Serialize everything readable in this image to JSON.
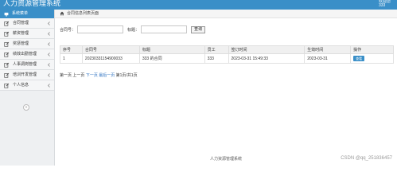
{
  "app": {
    "title": "人力资源管理系统",
    "user_line1": "欢迎您",
    "user_line2": "333"
  },
  "sidebar": {
    "header": "系统菜单",
    "items": [
      {
        "label": "合同管理"
      },
      {
        "label": "薪资管理"
      },
      {
        "label": "奖惩管理"
      },
      {
        "label": "绩效出勤管理"
      },
      {
        "label": "人事调岗管理"
      },
      {
        "label": "培训开发管理"
      },
      {
        "label": "个人信息"
      }
    ],
    "collapse_glyph": "«"
  },
  "breadcrumb": {
    "text": "合同信息列表页面"
  },
  "search": {
    "label1": "合同号：",
    "label2": "标题：",
    "button": "查询",
    "value1": "",
    "value2": ""
  },
  "table": {
    "headers": [
      "序号",
      "合同号",
      "标题",
      "员工",
      "签订时间",
      "生效时间",
      "操作"
    ],
    "rows": [
      [
        "1",
        "20230331154900033",
        "333 的合同",
        "333",
        "2023-03-31 15:49:33",
        "2023-03-31",
        "查看"
      ]
    ]
  },
  "pager": {
    "first": "第一页",
    "prev": "上一页",
    "next": "下一页",
    "last": "最后一页",
    "info": "第1页/共1页"
  },
  "footer": {
    "text": "人力资源管理系统"
  },
  "watermark": {
    "text": "CSDN @qq_251836457"
  },
  "colors": {
    "accent": "#3a8fc8"
  }
}
